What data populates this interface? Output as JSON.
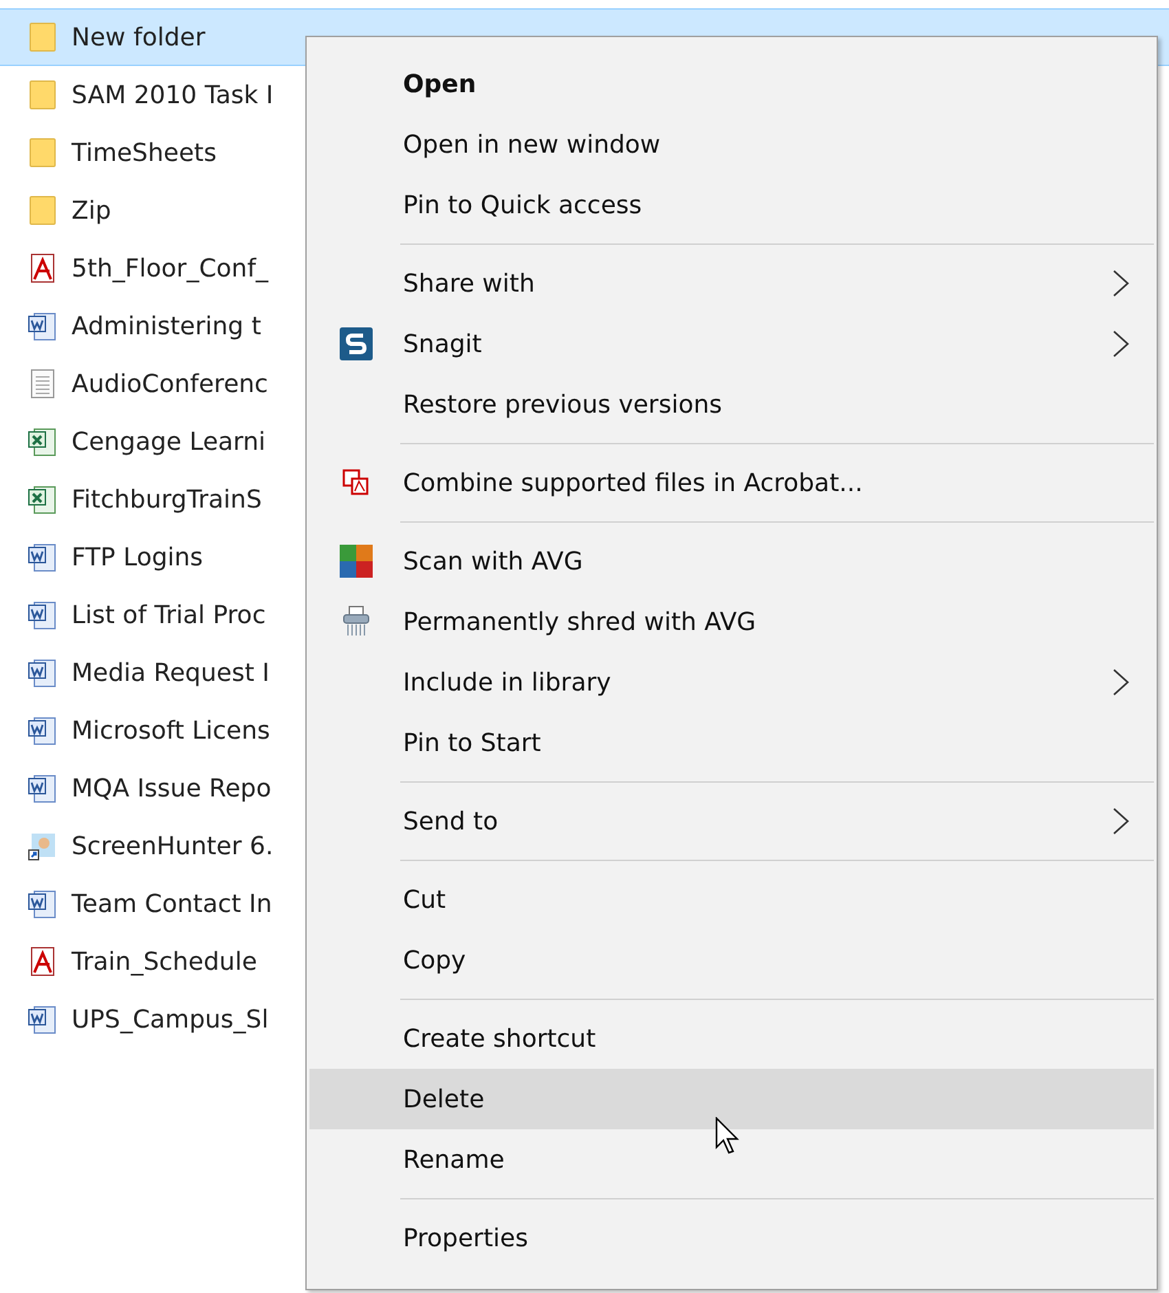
{
  "files": [
    {
      "name": "New folder",
      "kind": "folder",
      "selected": true
    },
    {
      "name": "SAM 2010 Task I",
      "kind": "folder",
      "selected": false
    },
    {
      "name": "TimeSheets",
      "kind": "folder",
      "selected": false
    },
    {
      "name": "Zip",
      "kind": "folder",
      "selected": false
    },
    {
      "name": "5th_Floor_Conf_",
      "kind": "pdf",
      "selected": false
    },
    {
      "name": "Administering t",
      "kind": "word",
      "selected": false
    },
    {
      "name": "AudioConferenc",
      "kind": "text",
      "selected": false
    },
    {
      "name": "Cengage Learni",
      "kind": "excel",
      "selected": false
    },
    {
      "name": "FitchburgTrainS",
      "kind": "excel",
      "selected": false
    },
    {
      "name": "FTP Logins",
      "kind": "word",
      "selected": false
    },
    {
      "name": "List of Trial Proc",
      "kind": "word",
      "selected": false
    },
    {
      "name": "Media Request I",
      "kind": "word",
      "selected": false
    },
    {
      "name": "Microsoft Licens",
      "kind": "word",
      "selected": false
    },
    {
      "name": "MQA Issue Repo",
      "kind": "word",
      "selected": false
    },
    {
      "name": "ScreenHunter 6.",
      "kind": "image",
      "selected": false
    },
    {
      "name": "Team Contact In",
      "kind": "word",
      "selected": false
    },
    {
      "name": "Train_Schedule",
      "kind": "pdf",
      "selected": false
    },
    {
      "name": "UPS_Campus_Sl",
      "kind": "word",
      "selected": false
    }
  ],
  "context_menu": [
    {
      "kind": "item",
      "label": "Open",
      "default": true,
      "submenu": false,
      "highlighted": false
    },
    {
      "kind": "item",
      "label": "Open in new window",
      "default": false,
      "submenu": false,
      "highlighted": false
    },
    {
      "kind": "item",
      "label": "Pin to Quick access",
      "default": false,
      "submenu": false,
      "highlighted": false
    },
    {
      "kind": "separator"
    },
    {
      "kind": "item",
      "label": "Share with",
      "default": false,
      "submenu": true,
      "highlighted": false
    },
    {
      "kind": "item",
      "label": "Snagit",
      "default": false,
      "submenu": true,
      "highlighted": false
    },
    {
      "kind": "item",
      "label": "Restore previous versions",
      "default": false,
      "submenu": false,
      "highlighted": false
    },
    {
      "kind": "separator"
    },
    {
      "kind": "item",
      "label": "Combine supported files in Acrobat...",
      "default": false,
      "submenu": false,
      "highlighted": false
    },
    {
      "kind": "separator"
    },
    {
      "kind": "item",
      "label": "Scan with AVG",
      "default": false,
      "submenu": false,
      "highlighted": false
    },
    {
      "kind": "item",
      "label": "Permanently shred with AVG",
      "default": false,
      "submenu": false,
      "highlighted": false
    },
    {
      "kind": "item",
      "label": "Include in library",
      "default": false,
      "submenu": true,
      "highlighted": false
    },
    {
      "kind": "item",
      "label": "Pin to Start",
      "default": false,
      "submenu": false,
      "highlighted": false
    },
    {
      "kind": "separator"
    },
    {
      "kind": "item",
      "label": "Send to",
      "default": false,
      "submenu": true,
      "highlighted": false
    },
    {
      "kind": "separator"
    },
    {
      "kind": "item",
      "label": "Cut",
      "default": false,
      "submenu": false,
      "highlighted": false
    },
    {
      "kind": "item",
      "label": "Copy",
      "default": false,
      "submenu": false,
      "highlighted": false
    },
    {
      "kind": "separator"
    },
    {
      "kind": "item",
      "label": "Create shortcut",
      "default": false,
      "submenu": false,
      "highlighted": false
    },
    {
      "kind": "item",
      "label": "Delete",
      "default": false,
      "submenu": false,
      "highlighted": true
    },
    {
      "kind": "item",
      "label": "Rename",
      "default": false,
      "submenu": false,
      "highlighted": false
    },
    {
      "kind": "separator"
    },
    {
      "kind": "item",
      "label": "Properties",
      "default": false,
      "submenu": false,
      "highlighted": false
    }
  ]
}
